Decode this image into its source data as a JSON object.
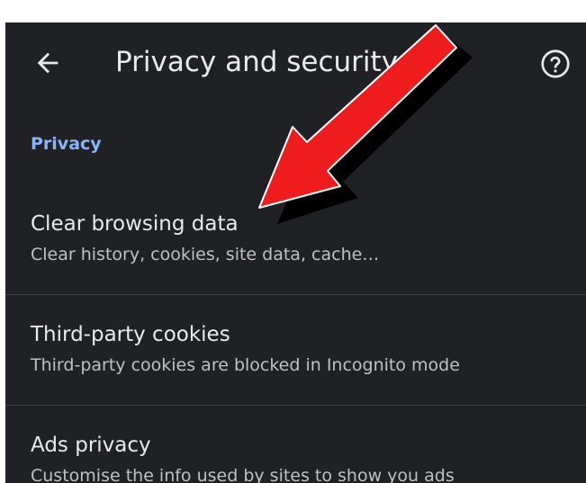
{
  "header": {
    "title": "Privacy and security",
    "back_icon": "arrow-left-icon",
    "help_icon": "help-circle-icon"
  },
  "section": {
    "title": "Privacy"
  },
  "items": [
    {
      "title": "Clear browsing data",
      "subtitle": "Clear history, cookies, site data, cache…"
    },
    {
      "title": "Third-party cookies",
      "subtitle": "Third-party cookies are blocked in Incognito mode"
    },
    {
      "title": "Ads privacy",
      "subtitle": "Customise the info used by sites to show you ads"
    }
  ],
  "colors": {
    "background": "#202124",
    "text_primary": "#e8eaed",
    "text_secondary": "#bdc1c6",
    "accent": "#8ab4f8",
    "annotation_arrow": "#ee1c1c"
  }
}
